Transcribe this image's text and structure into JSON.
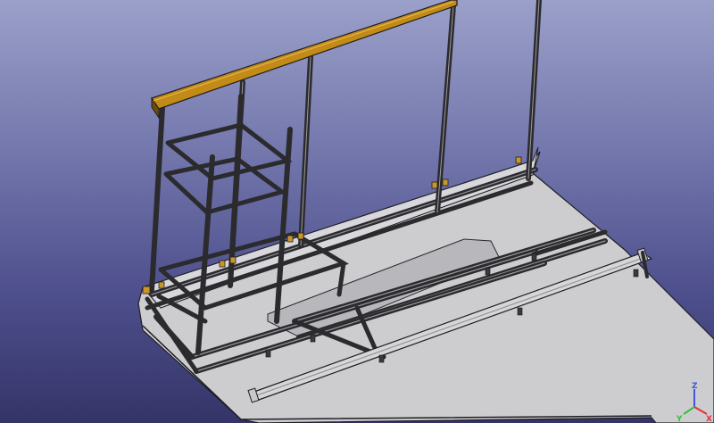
{
  "viewer": {
    "background_top": "#9aa0c9",
    "background_bottom": "#353468",
    "colors": {
      "frame": "#2b2b2e",
      "frame_highlight": "#9a9aa0",
      "panel": "#cdcdd0",
      "panel_edge": "#1e1e22",
      "beam": "#c28a16",
      "beam_dark": "#6e4c08",
      "bracket": "#c8962a",
      "rail": "#d6d6d8"
    }
  },
  "axis": {
    "x_label": "X",
    "y_label": "Y",
    "z_label": "Z",
    "x_color": "#e0303a",
    "y_color": "#2fc23a",
    "z_color": "#3e55e0",
    "icon": "axis-cross-icon"
  }
}
